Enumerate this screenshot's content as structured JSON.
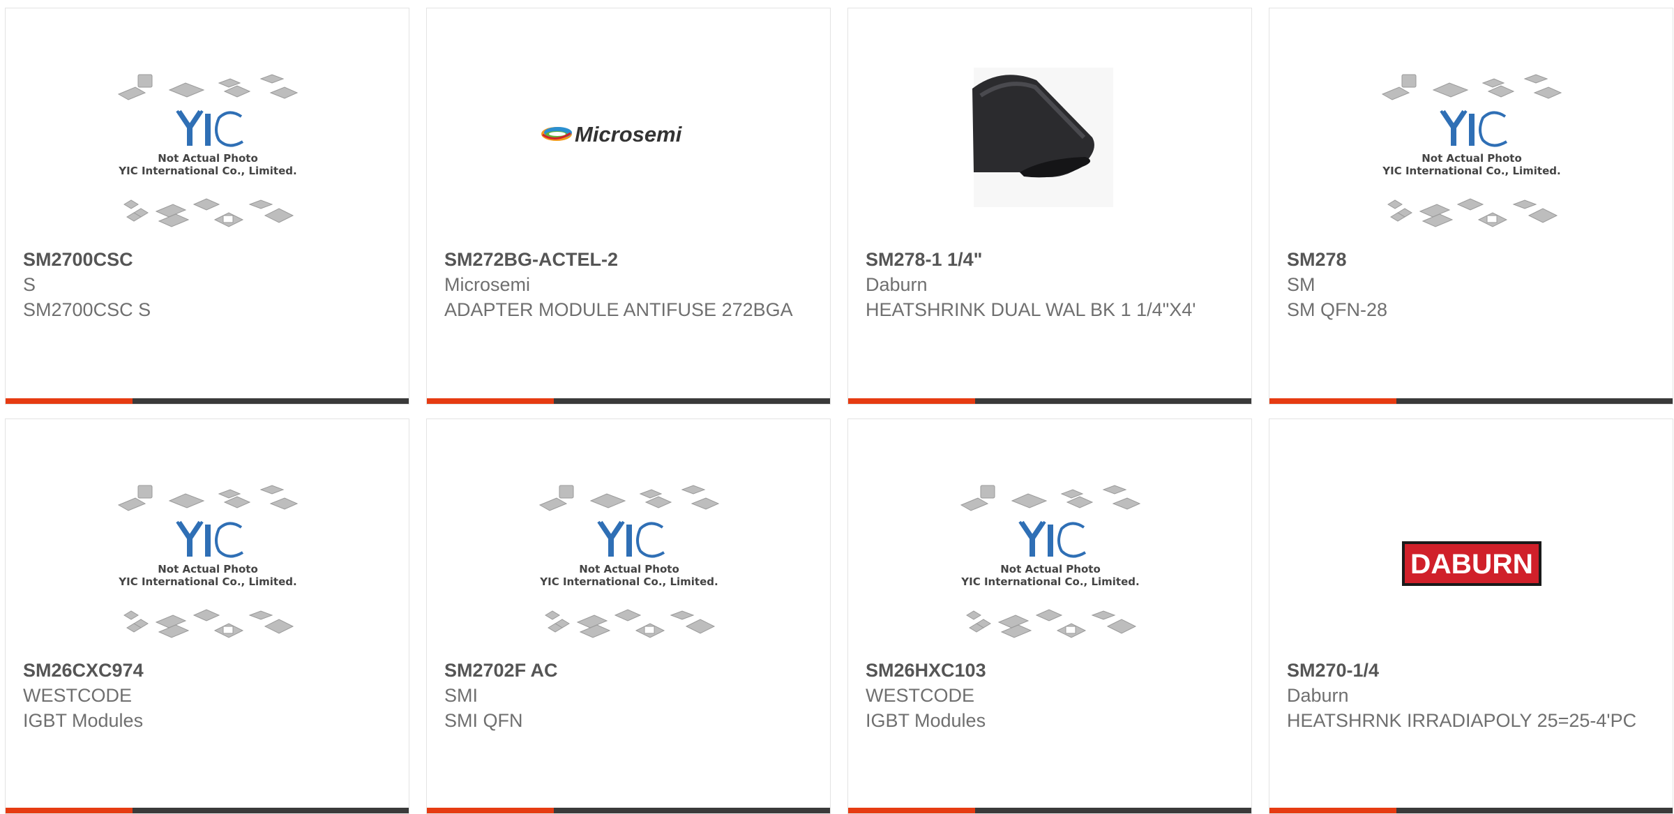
{
  "products": [
    {
      "part_number": "SM2700CSC",
      "manufacturer": "S",
      "description": "SM2700CSC S",
      "image": "placeholder",
      "placeholder_line1": "Not Actual Photo",
      "placeholder_line2": "YIC International Co., Limited."
    },
    {
      "part_number": "SM272BG-ACTEL-2",
      "manufacturer": "Microsemi",
      "description": "ADAPTER MODULE ANTIFUSE 272BGA",
      "image": "microsemi-logo",
      "logo_text": "Microsemi"
    },
    {
      "part_number": "SM278-1 1/4\"",
      "manufacturer": "Daburn",
      "description": "HEATSHRINK DUAL WAL BK 1 1/4\"X4'",
      "image": "heatshrink-photo"
    },
    {
      "part_number": "SM278",
      "manufacturer": "SM",
      "description": "SM QFN-28",
      "image": "placeholder",
      "placeholder_line1": "Not Actual Photo",
      "placeholder_line2": "YIC International Co., Limited."
    },
    {
      "part_number": "SM26CXC974",
      "manufacturer": "WESTCODE",
      "description": "IGBT Modules",
      "image": "placeholder",
      "placeholder_line1": "Not Actual Photo",
      "placeholder_line2": "YIC International Co., Limited."
    },
    {
      "part_number": "SM2702F AC",
      "manufacturer": "SMI",
      "description": "SMI QFN",
      "image": "placeholder",
      "placeholder_line1": "Not Actual Photo",
      "placeholder_line2": "YIC International Co., Limited."
    },
    {
      "part_number": "SM26HXC103",
      "manufacturer": "WESTCODE",
      "description": "IGBT Modules",
      "image": "placeholder",
      "placeholder_line1": "Not Actual Photo",
      "placeholder_line2": "YIC International Co., Limited."
    },
    {
      "part_number": "SM270-1/4",
      "manufacturer": "Daburn",
      "description": "HEATSHRNK IRRADIAPOLY 25=25-4'PC",
      "image": "daburn-logo",
      "logo_text": "DABURN"
    }
  ],
  "colors": {
    "accent": "#e63b12",
    "bar": "#3a3a3a",
    "yic_blue": "#2f6fb5",
    "daburn_red": "#d0202a"
  }
}
